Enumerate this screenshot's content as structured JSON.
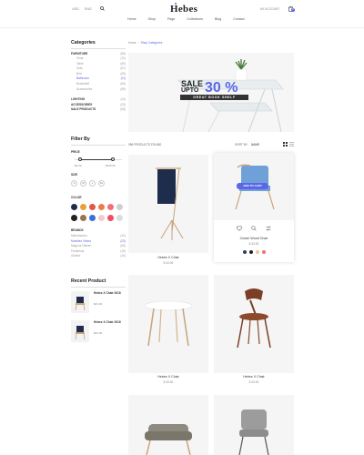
{
  "header": {
    "currency": "USD",
    "language": "ENG",
    "logo": "Hebes",
    "account": "MY ACCOUNT",
    "cart_count": "0",
    "nav": [
      "Home",
      "Shop",
      "Page",
      "Collections",
      "Blog",
      "Contact"
    ]
  },
  "sidebar": {
    "categories_title": "Categories",
    "furniture_label": "FURNITURE",
    "furniture_count": "(56)",
    "furniture_items": [
      {
        "label": "Chair",
        "count": "(12)"
      },
      {
        "label": "Table",
        "count": "(09)"
      },
      {
        "label": "Sofa",
        "count": "(07)"
      },
      {
        "label": "Bed",
        "count": "(05)"
      },
      {
        "label": "Bathroom",
        "count": "(11)"
      },
      {
        "label": "Bookshelf",
        "count": "(06)"
      },
      {
        "label": "Accessories",
        "count": "(06)"
      }
    ],
    "other_categories": [
      "LIGHTING",
      "ACCESSORIES",
      "SALE PRODUCTS"
    ],
    "other_counts": [
      "(14)",
      "(23)",
      "(08)"
    ],
    "filter_title": "Filter By",
    "price_label": "PRICE",
    "price_min": "$0.00",
    "price_max": "$425.00",
    "size_label": "SIZE",
    "sizes": [
      "S",
      "M",
      "L",
      "XL"
    ],
    "color_label": "COLOR",
    "colors": [
      "#1f2d4d",
      "#e8a03a",
      "#e0564b",
      "#e97d4a",
      "#f07079",
      "#cfcfcf",
      "#222222",
      "#9a7450",
      "#3d6fd8",
      "#f2c9d0",
      "#f44c62",
      "#dcdcdc"
    ],
    "brands_label": "BRANDS",
    "brands": [
      {
        "label": "Manufactum",
        "count": "(12)"
      },
      {
        "label": "Muebles Vitoria",
        "count": "(23)"
      },
      {
        "label": "Magnus Olesen",
        "count": "(08)"
      },
      {
        "label": "Fredericia",
        "count": "(15)"
      },
      {
        "label": "Gloster",
        "count": "(10)"
      }
    ],
    "recent_title": "Recent Product",
    "recent": [
      {
        "name": "Hebes X Chair 2018",
        "price": "$43.00"
      },
      {
        "name": "Hebes X Chair 2018",
        "price": "$43.00"
      }
    ]
  },
  "main": {
    "breadcrumb_home": "Home",
    "breadcrumb_current": "Shop Categories",
    "banner": {
      "sale": "SALE",
      "upto": "UPTO",
      "percent": "30 %",
      "subtitle": "GREAT BOOK SHELF"
    },
    "found": "056 PRODUCTS FOUND",
    "sort_label": "SORT BY:",
    "sort_value": "NAME",
    "add_to_cart": "ADD TO CART",
    "products": [
      {
        "name": "Hebes X Chair",
        "price": "$ 43.00"
      },
      {
        "name": "Cream Wood Chair",
        "price": "$ 43.00"
      },
      {
        "name": "Hebes X Chair",
        "price": "$ 43.00"
      },
      {
        "name": "Hebes X Chair",
        "price": "$ 43.00"
      }
    ],
    "swatches": [
      "#2b3e6e",
      "#222222",
      "#e8c79a",
      "#f07079"
    ]
  }
}
